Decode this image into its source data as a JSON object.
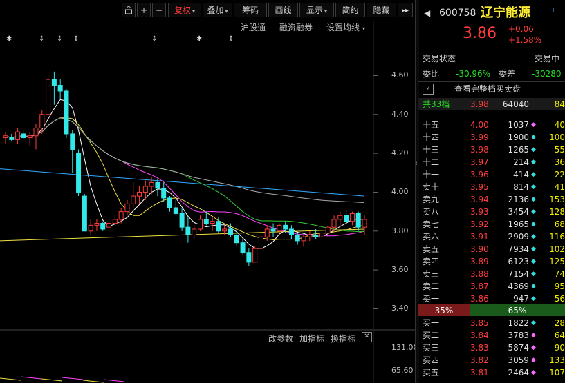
{
  "toolbar": {
    "fuquan": "复权",
    "diejia": "叠加",
    "chouma": "筹码",
    "huaxian": "画线",
    "xianshi": "显示",
    "jianyue": "简约",
    "yincang": "隐藏"
  },
  "subbar": {
    "hugutong": "沪股通",
    "rongzi": "融资融券",
    "junxian": "设置均线"
  },
  "chart_data": {
    "type": "candlestick",
    "y_ticks": [
      "4.60",
      "4.40",
      "4.20",
      "4.00",
      "3.80",
      "3.60",
      "3.40"
    ],
    "ylim": [
      3.32,
      4.74
    ],
    "candles": [
      [
        4.28,
        4.31,
        4.25,
        4.29
      ],
      [
        4.28,
        4.3,
        4.26,
        4.27
      ],
      [
        4.27,
        4.33,
        4.25,
        4.31
      ],
      [
        4.3,
        4.32,
        4.27,
        4.28
      ],
      [
        4.28,
        4.31,
        4.24,
        4.29
      ],
      [
        4.29,
        4.35,
        4.22,
        4.33
      ],
      [
        4.33,
        4.42,
        4.3,
        4.4
      ],
      [
        4.4,
        4.6,
        4.37,
        4.58
      ],
      [
        4.58,
        4.62,
        4.45,
        4.55
      ],
      [
        4.55,
        4.58,
        4.48,
        4.52
      ],
      [
        4.52,
        4.53,
        4.28,
        4.3
      ],
      [
        4.3,
        4.32,
        4.1,
        4.22
      ],
      [
        4.2,
        4.22,
        3.98,
        4.0
      ],
      [
        3.98,
        3.99,
        3.8,
        3.8
      ],
      [
        3.8,
        3.86,
        3.78,
        3.83
      ],
      [
        3.83,
        3.86,
        3.8,
        3.84
      ],
      [
        3.84,
        3.85,
        3.8,
        3.81
      ],
      [
        3.82,
        3.85,
        3.8,
        3.84
      ],
      [
        3.84,
        3.88,
        3.83,
        3.86
      ],
      [
        3.86,
        3.92,
        3.84,
        3.9
      ],
      [
        3.9,
        3.96,
        3.88,
        3.94
      ],
      [
        3.94,
        4.05,
        3.92,
        3.98
      ],
      [
        3.98,
        4.03,
        3.94,
        4.0
      ],
      [
        4.0,
        4.06,
        3.96,
        4.03
      ],
      [
        4.03,
        4.08,
        3.99,
        4.05
      ],
      [
        4.05,
        4.07,
        3.98,
        4.02
      ],
      [
        4.02,
        4.05,
        3.95,
        3.97
      ],
      [
        3.97,
        3.98,
        3.9,
        3.92
      ],
      [
        3.92,
        3.96,
        3.88,
        3.89
      ],
      [
        3.89,
        3.92,
        3.8,
        3.82
      ],
      [
        3.82,
        3.87,
        3.74,
        3.78
      ],
      [
        3.78,
        3.83,
        3.76,
        3.81
      ],
      [
        3.81,
        3.88,
        3.8,
        3.86
      ],
      [
        3.86,
        3.9,
        3.83,
        3.84
      ],
      [
        3.84,
        3.87,
        3.8,
        3.85
      ],
      [
        3.85,
        3.87,
        3.79,
        3.8
      ],
      [
        3.8,
        3.83,
        3.78,
        3.81
      ],
      [
        3.81,
        3.84,
        3.77,
        3.78
      ],
      [
        3.78,
        3.8,
        3.72,
        3.74
      ],
      [
        3.74,
        3.76,
        3.68,
        3.69
      ],
      [
        3.69,
        3.71,
        3.62,
        3.64
      ],
      [
        3.64,
        3.72,
        3.64,
        3.71
      ],
      [
        3.71,
        3.78,
        3.7,
        3.77
      ],
      [
        3.77,
        3.83,
        3.75,
        3.81
      ],
      [
        3.81,
        3.84,
        3.77,
        3.8
      ],
      [
        3.8,
        3.84,
        3.78,
        3.83
      ],
      [
        3.83,
        3.85,
        3.79,
        3.81
      ],
      [
        3.81,
        3.83,
        3.76,
        3.78
      ],
      [
        3.78,
        3.79,
        3.73,
        3.75
      ],
      [
        3.75,
        3.78,
        3.72,
        3.77
      ],
      [
        3.77,
        3.8,
        3.75,
        3.78
      ],
      [
        3.78,
        3.81,
        3.76,
        3.77
      ],
      [
        3.77,
        3.8,
        3.76,
        3.79
      ],
      [
        3.79,
        3.83,
        3.77,
        3.82
      ],
      [
        3.82,
        3.88,
        3.8,
        3.86
      ],
      [
        3.86,
        3.9,
        3.83,
        3.88
      ],
      [
        3.88,
        3.91,
        3.84,
        3.85
      ],
      [
        3.85,
        3.9,
        3.83,
        3.89
      ],
      [
        3.89,
        3.9,
        3.8,
        3.82
      ],
      [
        3.82,
        3.88,
        3.78,
        3.86
      ]
    ],
    "vol_ticks": [
      "131.00",
      "65.60"
    ]
  },
  "volume_header": {
    "gaican": "改参数",
    "jiazhibiao": "加指标",
    "huanzhibiao": "换指标"
  },
  "quote": {
    "code": "600758",
    "name": "辽宁能源",
    "flag": "T",
    "price": "3.86",
    "change": "+0.06",
    "change_pct": "+1.58%",
    "status_label": "交易状态",
    "status_value": "交易中",
    "weibi_label": "委比",
    "weibi_value": "-30.96%",
    "weicha_label": "委差",
    "weicha_value": "-30280",
    "full_book": "查看完整档买卖盘",
    "levels_label": "共33档",
    "levels_price": "3.98",
    "levels_vol": "64040",
    "levels_cnt": "84"
  },
  "asks": [
    {
      "label": "十五",
      "price": "4.00",
      "vol": "1037",
      "cnt": "40",
      "dot": "#ff66ff"
    },
    {
      "label": "十四",
      "price": "3.99",
      "vol": "1900",
      "cnt": "100",
      "dot": "#33dddd"
    },
    {
      "label": "十三",
      "price": "3.98",
      "vol": "1265",
      "cnt": "55",
      "dot": "#33dddd"
    },
    {
      "label": "十二",
      "price": "3.97",
      "vol": "214",
      "cnt": "36",
      "dot": "#33dddd"
    },
    {
      "label": "十一",
      "price": "3.96",
      "vol": "414",
      "cnt": "22",
      "dot": "#33dddd"
    },
    {
      "label": "卖十",
      "price": "3.95",
      "vol": "814",
      "cnt": "41",
      "dot": "#33dddd"
    },
    {
      "label": "卖九",
      "price": "3.94",
      "vol": "2136",
      "cnt": "153",
      "dot": "#33dddd"
    },
    {
      "label": "卖八",
      "price": "3.93",
      "vol": "3454",
      "cnt": "128",
      "dot": "#33dddd"
    },
    {
      "label": "卖七",
      "price": "3.92",
      "vol": "1965",
      "cnt": "68",
      "dot": "#33dddd"
    },
    {
      "label": "卖六",
      "price": "3.91",
      "vol": "2909",
      "cnt": "116",
      "dot": "#33dddd"
    },
    {
      "label": "卖五",
      "price": "3.90",
      "vol": "7934",
      "cnt": "102",
      "dot": "#33dddd"
    },
    {
      "label": "卖四",
      "price": "3.89",
      "vol": "6123",
      "cnt": "125",
      "dot": "#33dddd"
    },
    {
      "label": "卖三",
      "price": "3.88",
      "vol": "7154",
      "cnt": "74",
      "dot": "#33dddd"
    },
    {
      "label": "卖二",
      "price": "3.87",
      "vol": "4369",
      "cnt": "95",
      "dot": "#33dddd"
    },
    {
      "label": "卖一",
      "price": "3.86",
      "vol": "947",
      "cnt": "56",
      "dot": "#33dddd"
    }
  ],
  "ratio": {
    "buy": "35%",
    "sell": "65%",
    "buy_frac": 0.35
  },
  "bids": [
    {
      "label": "买一",
      "price": "3.85",
      "vol": "1822",
      "cnt": "28",
      "dot": "#33dddd"
    },
    {
      "label": "买二",
      "price": "3.84",
      "vol": "3783",
      "cnt": "64",
      "dot": "#ff66ff"
    },
    {
      "label": "买三",
      "price": "3.83",
      "vol": "5874",
      "cnt": "90",
      "dot": "#ff66ff"
    },
    {
      "label": "买四",
      "price": "3.82",
      "vol": "3059",
      "cnt": "133",
      "dot": "#ff66ff"
    },
    {
      "label": "买五",
      "price": "3.81",
      "vol": "2464",
      "cnt": "107",
      "dot": "#ff66ff"
    }
  ]
}
